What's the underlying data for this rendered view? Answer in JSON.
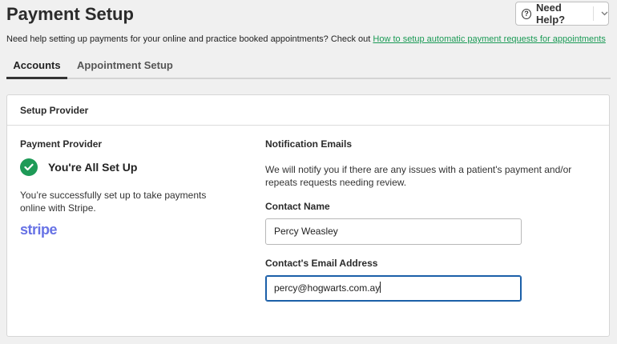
{
  "header": {
    "title": "Payment Setup",
    "help_label": "Need Help?",
    "help_icon": "question-circle-icon",
    "subtitle_text": "Need help setting up payments for your online and practice booked appointments? Check out",
    "subtitle_link": "How to setup automatic payment requests for appointments"
  },
  "tabs": [
    {
      "label": "Accounts",
      "active": true
    },
    {
      "label": "Appointment Setup",
      "active": false
    }
  ],
  "card": {
    "title": "Setup Provider",
    "provider": {
      "label": "Payment Provider",
      "status": "You're All Set Up",
      "description": "You’re successfully set up to take payments online with Stripe.",
      "logo_text": "stripe",
      "status_color": "#1e9a57",
      "logo_color": "#6772e5"
    },
    "notifications": {
      "label": "Notification Emails",
      "description": "We will notify you if there are any issues with a patient's payment and/or repeats requests needing review.",
      "contact_name_label": "Contact Name",
      "contact_name_value": "Percy Weasley",
      "contact_email_label": "Contact's Email Address",
      "contact_email_value": "percy@hogwarts.com.ay"
    }
  },
  "colors": {
    "link": "#1a9a55",
    "focus": "#1b5fa8"
  }
}
